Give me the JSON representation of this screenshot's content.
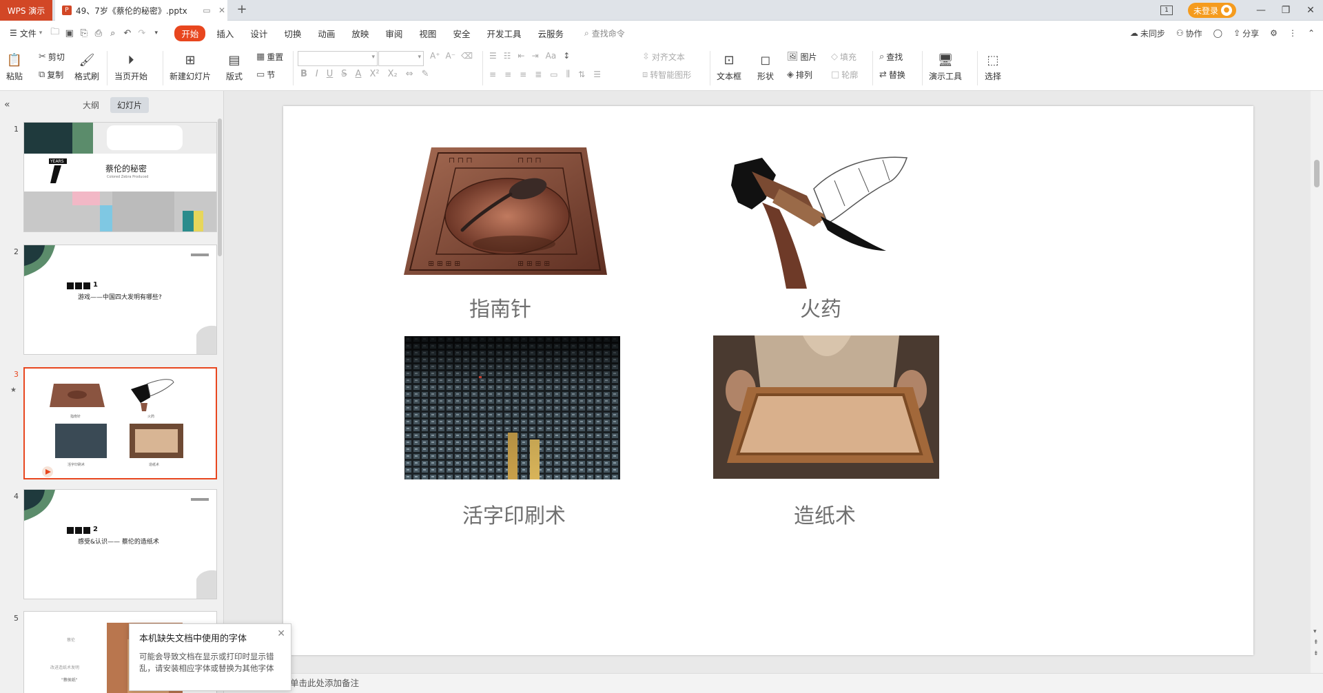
{
  "titlebar": {
    "app_name": "WPS 演示",
    "doc_tab": "49、7岁《蔡伦的秘密》.pptx",
    "login_label": "未登录"
  },
  "menubar": {
    "file_label": "文件",
    "tabs": [
      "开始",
      "插入",
      "设计",
      "切换",
      "动画",
      "放映",
      "审阅",
      "视图",
      "安全",
      "开发工具",
      "云服务"
    ],
    "active_tab": "开始",
    "search_placeholder": "查找命令",
    "right": {
      "sync": "未同步",
      "collab": "协作",
      "share": "分享"
    }
  },
  "ribbon": {
    "paste": "粘贴",
    "cut": "剪切",
    "copy": "复制",
    "format_painter": "格式刷",
    "play_from_current": "当页开始",
    "new_slide": "新建幻灯片",
    "layout": "版式",
    "reset": "重置",
    "section": "节",
    "align_text": "对齐文本",
    "smart_art": "转智能图形",
    "text_box": "文本框",
    "shapes": "形状",
    "picture": "图片",
    "arrange": "排列",
    "fill": "填充",
    "outline": "轮廓",
    "find": "查找",
    "replace": "替换",
    "presenter_tools": "演示工具",
    "select": "选择",
    "format_letters": {
      "bold": "B",
      "italic": "I",
      "underline": "U",
      "strike": "S",
      "font_color": "A",
      "superscript": "X²",
      "subscript": "X₂",
      "font_up": "A⁺",
      "font_down": "A⁻"
    }
  },
  "panel": {
    "tab_outline": "大纲",
    "tab_slides": "幻灯片",
    "slides": [
      {
        "num": "1",
        "title": "蔡伦的秘密",
        "subtitle": "Colored Zebra Produced",
        "badge": "YEARS"
      },
      {
        "num": "2",
        "step": "1",
        "text": "游戏——中国四大发明有哪些?"
      },
      {
        "num": "3",
        "labels": [
          "指南针",
          "火药",
          "活字印刷术",
          "造纸术"
        ]
      },
      {
        "num": "4",
        "step": "2",
        "text": "感受&认识—— 蔡伦的造纸术"
      },
      {
        "num": "5",
        "lines": [
          "蔡伦",
          "改进造纸术发明",
          "\"蔡侯纸\""
        ]
      }
    ]
  },
  "slide": {
    "captions": {
      "compass": "指南针",
      "gunpowder": "火药",
      "printing": "活字印刷术",
      "paper": "造纸术"
    }
  },
  "notes": {
    "placeholder": "单击此处添加备注"
  },
  "toast": {
    "title": "本机缺失文档中使用的字体",
    "body": "可能会导致文档在显示或打印时显示错乱，请安装相应字体或替换为其他字体"
  },
  "colors": {
    "accent": "#e8461e",
    "brand": "#d24726",
    "login": "#f59b1d",
    "dark_green": "#1f3a3d",
    "green": "#5b8c6b"
  }
}
